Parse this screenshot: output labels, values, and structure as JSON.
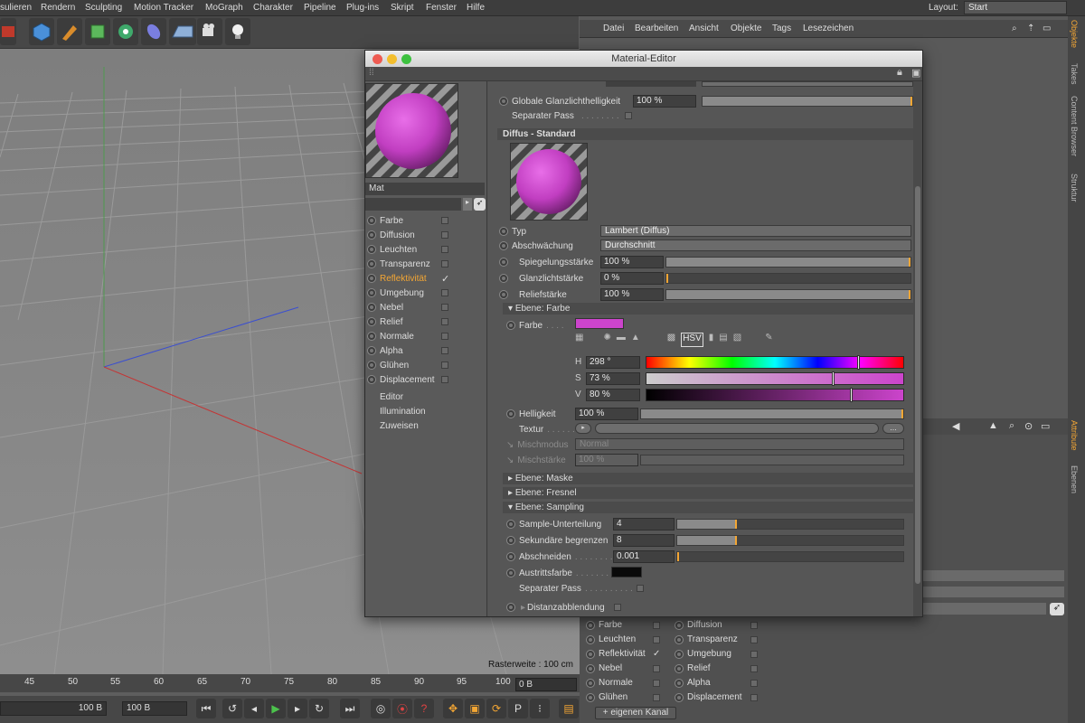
{
  "menubar": {
    "items": [
      "sulieren",
      "Rendern",
      "Sculpting",
      "Motion Tracker",
      "MoGraph",
      "Charakter",
      "Pipeline",
      "Plug-ins",
      "Skript",
      "Fenster",
      "Hilfe"
    ],
    "layout_label": "Layout:",
    "layout_value": "Start"
  },
  "viewport": {
    "raster_text": "Rasterweite : 100 cm"
  },
  "timeline": {
    "ticks": [
      "45",
      "50",
      "55",
      "60",
      "65",
      "70",
      "75",
      "80",
      "85",
      "90",
      "95",
      "100"
    ],
    "frame_field": "0 B"
  },
  "transport": {
    "field_a": "100 B",
    "field_b": "100 B"
  },
  "object_manager": {
    "menu": [
      "Datei",
      "Bearbeiten",
      "Ansicht",
      "Objekte",
      "Tags",
      "Lesezeichen"
    ]
  },
  "right_tabs": [
    "Objekte",
    "Takes",
    "Content Browser",
    "Struktur",
    "Attribute",
    "Ebenen"
  ],
  "attr_channels": {
    "left": [
      "Farbe",
      "Leuchten",
      "Reflektivität",
      "Nebel",
      "Normale",
      "Glühen"
    ],
    "right": [
      "Diffusion",
      "Transparenz",
      "Umgebung",
      "Relief",
      "Alpha",
      "Displacement"
    ],
    "add_button": "+ eigenen Kanal"
  },
  "material_editor": {
    "title": "Material-Editor",
    "mat_name": "Mat",
    "channels": [
      {
        "label": "Farbe",
        "checked": false
      },
      {
        "label": "Diffusion",
        "checked": false
      },
      {
        "label": "Leuchten",
        "checked": false
      },
      {
        "label": "Transparenz",
        "checked": false
      },
      {
        "label": "Reflektivität",
        "checked": true
      },
      {
        "label": "Umgebung",
        "checked": false
      },
      {
        "label": "Nebel",
        "checked": false
      },
      {
        "label": "Relief",
        "checked": false
      },
      {
        "label": "Normale",
        "checked": false
      },
      {
        "label": "Alpha",
        "checked": false
      },
      {
        "label": "Glühen",
        "checked": false
      },
      {
        "label": "Displacement",
        "checked": false
      }
    ],
    "extra_items": [
      "Editor",
      "Illumination",
      "Zuweisen"
    ],
    "props": {
      "global_gloss_label": "Globale Glanzlichthelligkeit",
      "global_gloss_value": "100 %",
      "separate_pass": "Separater Pass",
      "section_diffus": "Diffus - Standard",
      "typ_label": "Typ",
      "typ_value": "Lambert (Diffus)",
      "abs_label": "Abschwächung",
      "abs_value": "Durchschnitt",
      "spieg_label": "Spiegelungsstärke",
      "spieg_value": "100 %",
      "glanz_label": "Glanzlichtstärke",
      "glanz_value": "0 %",
      "relief_label": "Reliefstärke",
      "relief_value": "100 %",
      "sec_farbe": "Ebene: Farbe",
      "farbe_label": "Farbe",
      "farbe_color": "#cc44cc",
      "h_label": "H",
      "h_value": "298 °",
      "h_level": 0.83,
      "s_label": "S",
      "s_value": "73 %",
      "s_level": 0.73,
      "v_label": "V",
      "v_value": "80 %",
      "v_level": 0.8,
      "hell_label": "Helligkeit",
      "hell_value": "100 %",
      "textur_label": "Textur",
      "mischmodus_label": "Mischmodus",
      "mischmodus_value": "Normal",
      "mischstaerke_label": "Mischstärke",
      "mischstaerke_value": "100 %",
      "sec_maske": "Ebene: Maske",
      "sec_fresnel": "Ebene: Fresnel",
      "sec_sampling": "Ebene: Sampling",
      "sample_label": "Sample-Unterteilung",
      "sample_value": "4",
      "sek_label": "Sekundäre begrenzen",
      "sek_value": "8",
      "abschn_label": "Abschneiden",
      "abschn_value": "0.001",
      "austritt_label": "Austrittsfarbe",
      "sep_pass2": "Separater Pass",
      "distanz_label": "Distanzabblendung"
    }
  },
  "colors": {
    "accent": "#f3a634",
    "material": "#cc44cc"
  }
}
